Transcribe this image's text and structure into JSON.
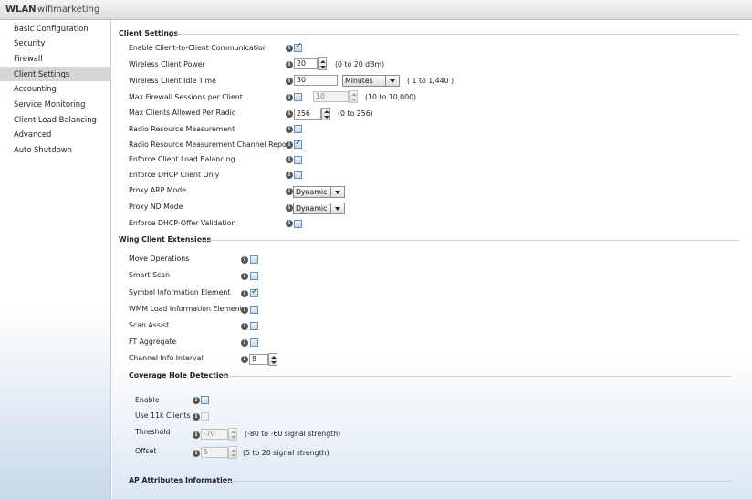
{
  "window": {
    "title_prefix": "WLAN",
    "title_name": "wifimarketing"
  },
  "sidebar": {
    "items": [
      {
        "label": "Basic Configuration"
      },
      {
        "label": "Security"
      },
      {
        "label": "Firewall"
      },
      {
        "label": "Client Settings",
        "active": true
      },
      {
        "label": "Accounting"
      },
      {
        "label": "Service Monitoring"
      },
      {
        "label": "Client Load Balancing"
      },
      {
        "label": "Advanced"
      },
      {
        "label": "Auto Shutdown"
      }
    ]
  },
  "client_settings": {
    "title": "Client Settings",
    "c2c": {
      "label": "Enable Client-to-Client Communication",
      "checked": true
    },
    "power": {
      "label": "Wireless Client Power",
      "value": "20",
      "hint": "(0 to 20 dBm)"
    },
    "idle": {
      "label": "Wireless Client Idle Time",
      "value": "30",
      "unit": "Minutes",
      "hint": "( 1 to 1,440 )"
    },
    "fw_sessions": {
      "label": "Max Firewall Sessions per Client",
      "value": "10",
      "hint": "(10 to 10,000)",
      "checked": false
    },
    "max_clients": {
      "label": "Max Clients Allowed Per Radio",
      "value": "256",
      "hint": "(0 to 256)"
    },
    "rrm": {
      "label": "Radio Resource Measurement",
      "checked": false
    },
    "rrm_channel": {
      "label": "Radio Resource Measurement Channel Report",
      "checked": true
    },
    "load_bal": {
      "label": "Enforce Client Load Balancing",
      "checked": false
    },
    "dhcp_only": {
      "label": "Enforce DHCP Client Only",
      "checked": false
    },
    "proxy_arp": {
      "label": "Proxy ARP Mode",
      "value": "Dynamic"
    },
    "proxy_nd": {
      "label": "Proxy ND Mode",
      "value": "Dynamic"
    },
    "dhcp_offer": {
      "label": "Enforce DHCP-Offer Validation",
      "checked": false
    }
  },
  "wing": {
    "title": "Wing Client Extensions",
    "move_ops": {
      "label": "Move Operations",
      "checked": false
    },
    "smart_scan": {
      "label": "Smart Scan",
      "checked": false
    },
    "symbol_ie": {
      "label": "Symbol Information Element",
      "checked": true
    },
    "wmm_load": {
      "label": "WMM Load Information Element",
      "checked": false
    },
    "scan_assist": {
      "label": "Scan Assist",
      "checked": false
    },
    "ft_aggregate": {
      "label": "FT Aggregate",
      "checked": false
    },
    "channel_info": {
      "label": "Channel Info Interval",
      "value": "8"
    }
  },
  "coverage": {
    "title": "Coverage Hole Detection",
    "enable": {
      "label": "Enable",
      "checked": false
    },
    "use11k": {
      "label": "Use 11k Clients",
      "checked": false
    },
    "threshold": {
      "label": "Threshold",
      "value": "-70",
      "hint": "(-80 to -60 signal strength)"
    },
    "offset": {
      "label": "Offset",
      "value": "5",
      "hint": "(5 to 20 signal strength)"
    }
  },
  "ap_attr": {
    "title": "AP Attributes Information"
  },
  "colors": {
    "accent": "#1f4f7a",
    "sidebar_active": "#d6d6d6",
    "checkbox_border": "#6f8fb0"
  }
}
